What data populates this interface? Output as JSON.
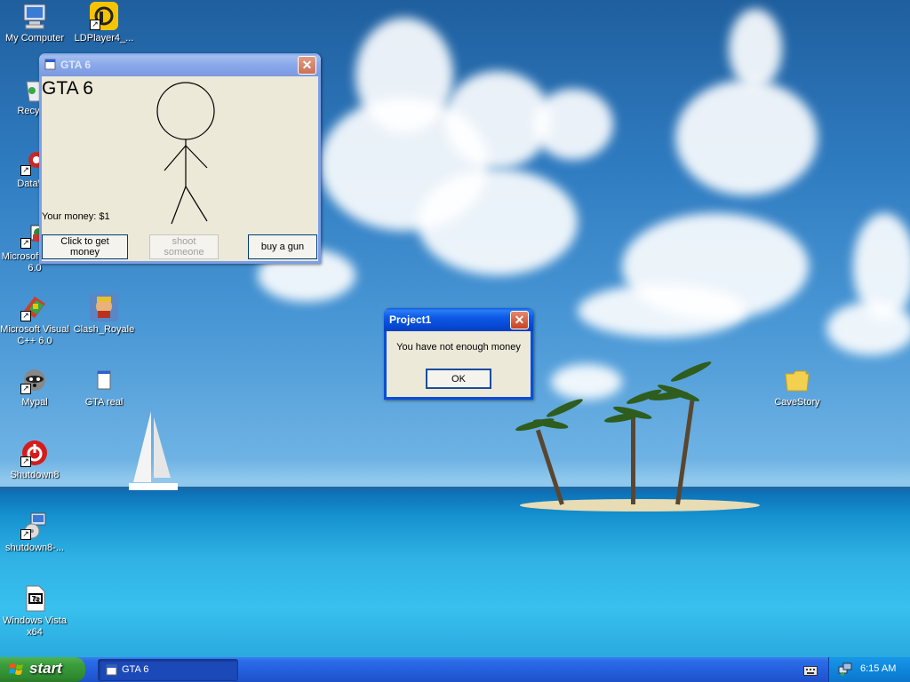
{
  "desktop": {
    "icons": [
      {
        "label": "My Computer"
      },
      {
        "label": "LDPlayer4_..."
      },
      {
        "label": "Recycle"
      },
      {
        "label": "DataWa"
      },
      {
        "label": "Microsoft Basic 6.0"
      },
      {
        "label": "Microsoft Visual C++ 6.0"
      },
      {
        "label": "Clash_Royale"
      },
      {
        "label": "Mypal"
      },
      {
        "label": "GTA real"
      },
      {
        "label": "Shutdown8"
      },
      {
        "label": "shutdown8-..."
      },
      {
        "label": "Windows Vista x64"
      },
      {
        "label": "CaveStory"
      }
    ],
    "icon_glyphs": {
      "7z": "7z"
    }
  },
  "gta_window": {
    "title": "GTA 6",
    "heading": "GTA 6",
    "money_text": "Your money: $1",
    "buttons": {
      "get_money": "Click to get money",
      "shoot": "shoot someone",
      "buy_gun": "buy a gun"
    }
  },
  "dialog": {
    "title": "Project1",
    "message": "You have not enough money",
    "ok_label": "OK"
  },
  "taskbar": {
    "start_label": "start",
    "tasks": [
      {
        "label": "GTA 6"
      }
    ],
    "clock": "6:15 AM"
  },
  "colors": {
    "xp_blue": "#0a4ed6",
    "start_green": "#3c9d3c",
    "window_face": "#ece9d8"
  }
}
